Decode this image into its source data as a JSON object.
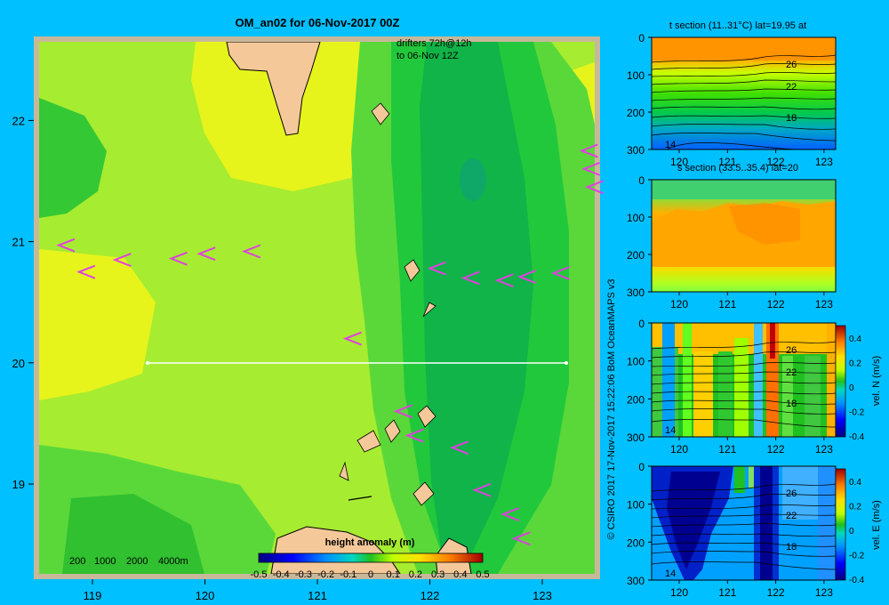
{
  "chart_data": [
    {
      "type": "heatmap",
      "title": "OM_an02 for 06-Nov-2017 00Z",
      "annotation": [
        "drifters 72h@12h",
        "to 06-Nov 12Z"
      ],
      "xlim": [
        118.5,
        123.5
      ],
      "ylim": [
        18.3,
        22.7
      ],
      "x_ticks": [
        "119",
        "120",
        "121",
        "122",
        "123"
      ],
      "y_ticks": [
        "19",
        "20",
        "21",
        "22"
      ],
      "section_line": {
        "lat": 20,
        "lon_from": 119.5,
        "lon_to": 123.2
      },
      "depth_legend": [
        "200",
        "1000",
        "2000",
        "4000m"
      ],
      "colorbar": {
        "label": "height anomaly (m)",
        "ticks": [
          "-0.5",
          "-0.4",
          "-0.3",
          "-0.2",
          "-0.1",
          "0",
          "0.1",
          "0.2",
          "0.3",
          "0.4",
          "0.5"
        ]
      },
      "drifters": [
        {
          "lon": 118.7,
          "lat": 20.97
        },
        {
          "lon": 118.88,
          "lat": 20.75
        },
        {
          "lon": 119.2,
          "lat": 20.85
        },
        {
          "lon": 119.7,
          "lat": 20.86
        },
        {
          "lon": 119.95,
          "lat": 20.9
        },
        {
          "lon": 120.35,
          "lat": 20.92
        },
        {
          "lon": 121.25,
          "lat": 20.2
        },
        {
          "lon": 122.0,
          "lat": 20.78
        },
        {
          "lon": 122.3,
          "lat": 20.7
        },
        {
          "lon": 122.6,
          "lat": 20.68
        },
        {
          "lon": 122.8,
          "lat": 20.71
        },
        {
          "lon": 123.1,
          "lat": 20.74
        },
        {
          "lon": 123.35,
          "lat": 21.75
        },
        {
          "lon": 123.37,
          "lat": 21.6
        },
        {
          "lon": 123.4,
          "lat": 21.45
        },
        {
          "lon": 121.7,
          "lat": 19.6
        },
        {
          "lon": 121.8,
          "lat": 19.4
        },
        {
          "lon": 122.2,
          "lat": 19.3
        },
        {
          "lon": 122.4,
          "lat": 18.95
        },
        {
          "lon": 122.65,
          "lat": 18.75
        },
        {
          "lon": 122.75,
          "lat": 18.55
        }
      ]
    },
    {
      "type": "heatmap",
      "title": "t section (11..31°C) lat=19.95 at",
      "x_ticks": [
        "120",
        "121",
        "122",
        "123"
      ],
      "y_ticks": [
        "0",
        "100",
        "200",
        "300"
      ],
      "contour_labels": [
        "26",
        "22",
        "18",
        "14"
      ]
    },
    {
      "type": "heatmap",
      "title": "s section (33.5..35.4) lat=20",
      "x_ticks": [
        "120",
        "121",
        "122",
        "123"
      ],
      "y_ticks": [
        "0",
        "100",
        "200",
        "300"
      ]
    },
    {
      "type": "heatmap",
      "x_ticks": [
        "120",
        "121",
        "122",
        "123"
      ],
      "y_ticks": [
        "0",
        "100",
        "200",
        "300"
      ],
      "contour_labels": [
        "26",
        "22",
        "18",
        "14"
      ],
      "colorbar": {
        "label": "vel. N (m/s)",
        "ticks": [
          "0.4",
          "0.2",
          "0",
          "-0.2",
          "-0.4"
        ]
      }
    },
    {
      "type": "heatmap",
      "x_ticks": [
        "120",
        "121",
        "122",
        "123"
      ],
      "y_ticks": [
        "0",
        "100",
        "200",
        "300"
      ],
      "contour_labels": [
        "26",
        "22",
        "18",
        "14"
      ],
      "colorbar": {
        "label": "vel. E (m/s)",
        "ticks": [
          "0.4",
          "0.2",
          "0",
          "-0.2",
          "-0.4"
        ]
      }
    }
  ],
  "credit": "© CSIRO 2017   17-Nov-2017 15:22:06 BoM OceanMAPS v3",
  "colors": {
    "background": "#00c0ff",
    "drifter": "#e040e0"
  }
}
